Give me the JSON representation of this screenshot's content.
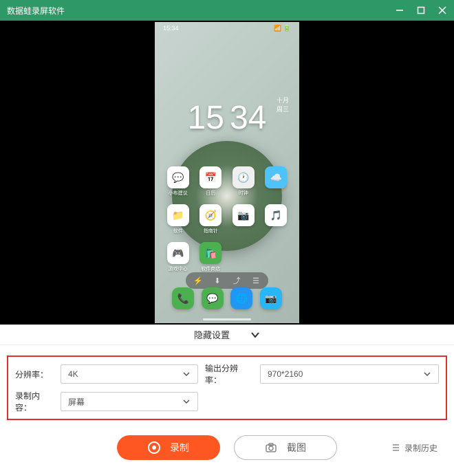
{
  "titlebar": {
    "title": "数据蛙录屏软件"
  },
  "phone": {
    "status_left": "15:34",
    "clock_h": "15",
    "clock_m": "34",
    "date_top": "十月",
    "date_bottom": "周三",
    "icon_labels": [
      "小布建议",
      "日历",
      "时钟",
      "软件",
      "指南针",
      "",
      "",
      "游戏中心",
      "软件商店"
    ],
    "dock_colors": [
      "#4caf50",
      "#4caf50",
      "#2196f3",
      "#2196f3"
    ]
  },
  "settings": {
    "header_label": "隐藏设置",
    "rows": {
      "resolution_label": "分辨率：",
      "resolution_value": "4K",
      "output_label": "输出分辨率：",
      "output_value": "970*2160",
      "content_label": "录制内容：",
      "content_value": "屏幕"
    }
  },
  "actions": {
    "record": "录制",
    "screenshot": "截图",
    "history": "录制历史"
  }
}
